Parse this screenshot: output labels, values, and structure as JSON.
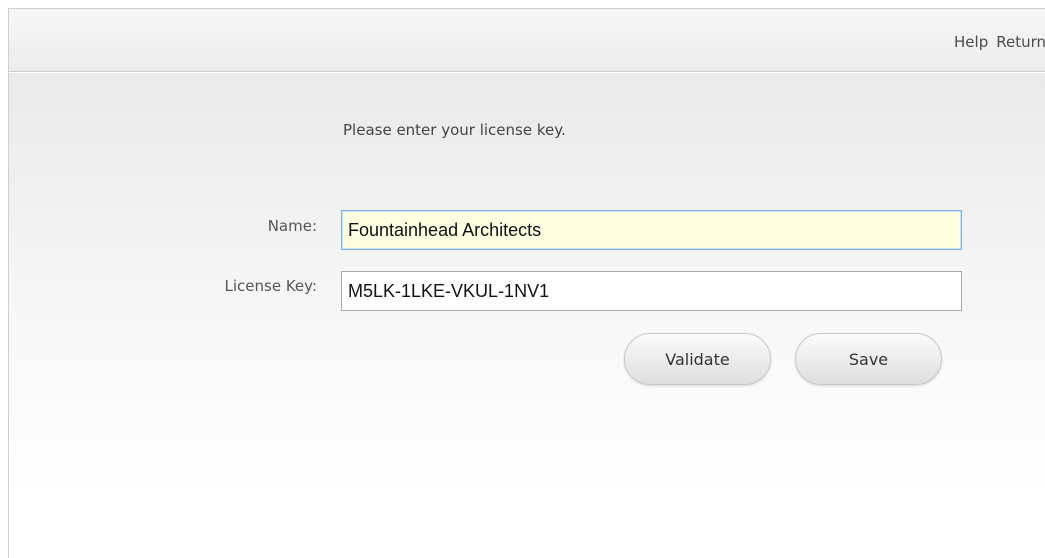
{
  "header": {
    "links": [
      {
        "label": "Help"
      },
      {
        "label": "Return"
      }
    ]
  },
  "form": {
    "prompt": "Please enter your license key.",
    "name_label": "Name:",
    "name_value": "Fountainhead Architects",
    "license_label": "License Key:",
    "license_value": "M5LK-1LKE-VKUL-1NV1",
    "validate_label": "Validate",
    "save_label": "Save"
  },
  "colors": {
    "focused_field_bg": "#ffffe1",
    "focused_field_border": "#7ab3e6"
  }
}
